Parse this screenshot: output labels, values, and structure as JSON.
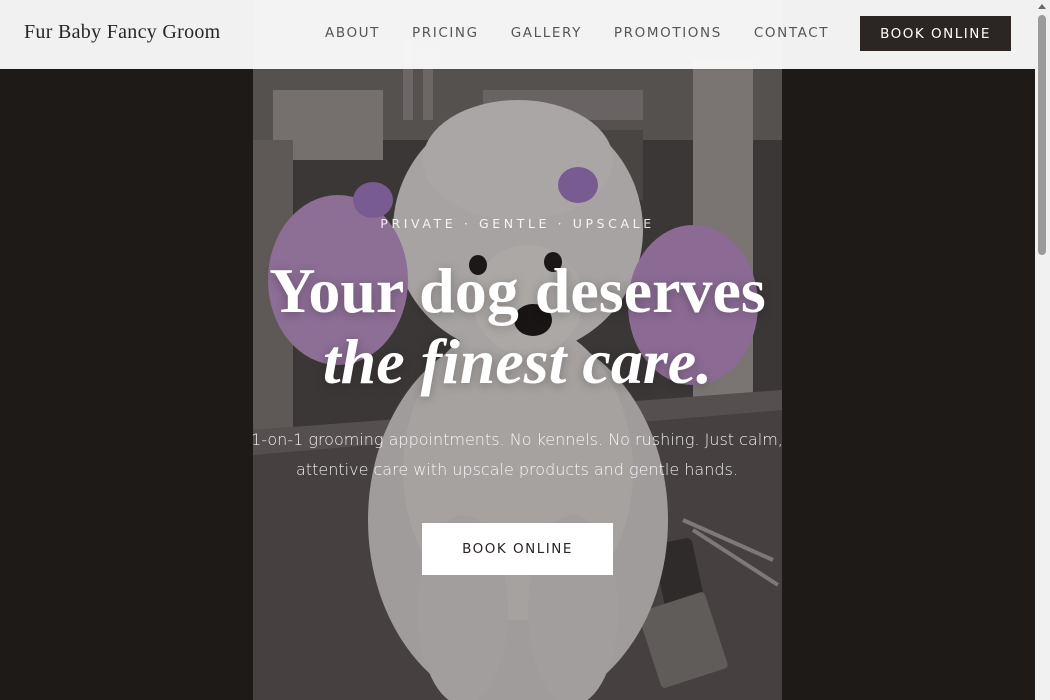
{
  "brand": {
    "name": "Fur Baby Fancy Groom"
  },
  "nav": {
    "items": [
      {
        "label": "ABOUT"
      },
      {
        "label": "PRICING"
      },
      {
        "label": "GALLERY"
      },
      {
        "label": "PROMOTIONS"
      },
      {
        "label": "CONTACT"
      }
    ],
    "cta_label": "BOOK ONLINE"
  },
  "hero": {
    "eyebrow": "PRIVATE · GENTLE · UPSCALE",
    "headline_line1": "Your dog deserves",
    "headline_line2": "the finest care.",
    "subtext": "1-on-1 grooming appointments. No kennels. No rushing. Just calm, attentive care with upscale products and gentle hands.",
    "cta_label": "BOOK ONLINE",
    "image_subject": "groomed white poodle with lavender ears on grooming table"
  },
  "colors": {
    "page_background": "#1e1a18",
    "header_background": "#fafafa",
    "dark_button": "#2b2523",
    "light_button": "#ffffff",
    "ear_accent": "#b58ac9"
  }
}
